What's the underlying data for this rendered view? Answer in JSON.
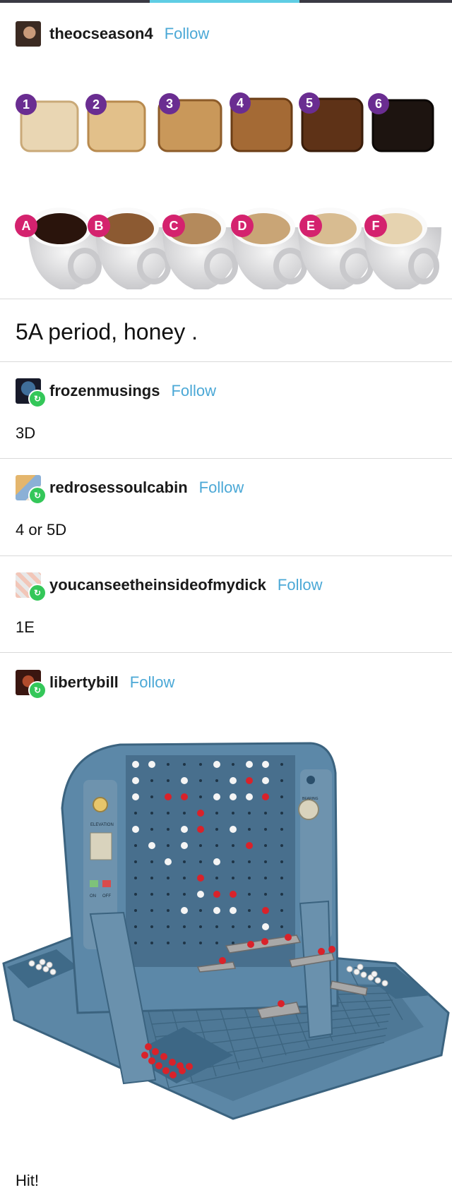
{
  "op": {
    "username": "theocseason4",
    "follow_label": "Follow",
    "image_numbers": [
      "1",
      "2",
      "3",
      "4",
      "5",
      "6"
    ],
    "image_letters": [
      "A",
      "B",
      "C",
      "D",
      "E",
      "F"
    ],
    "caption": "5A period, honey ."
  },
  "replies": [
    {
      "username": "frozenmusings",
      "follow_label": "Follow",
      "text": "3D"
    },
    {
      "username": "redrosessoulcabin",
      "follow_label": "Follow",
      "text": "4 or 5D"
    },
    {
      "username": "youcanseetheinsideofmydick",
      "follow_label": "Follow",
      "text": "1E"
    },
    {
      "username": "libertybill",
      "follow_label": "Follow",
      "text": "Hit!"
    }
  ],
  "battleship": {
    "elevation_label": "ELEVATION",
    "bearing_label": "BEARING",
    "on_label": "ON",
    "off_label": "OFF"
  },
  "colors": {
    "follow": "#4ba8d6",
    "reblog_badge": "#34c759",
    "tab_highlight": "#5fcde4"
  }
}
